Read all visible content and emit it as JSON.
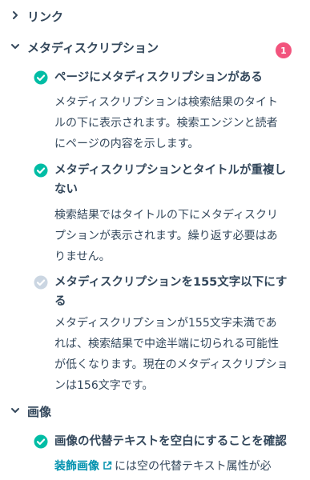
{
  "sections": {
    "links": {
      "title": "リンク",
      "expanded": false
    },
    "meta": {
      "title": "メタディスクリプション",
      "expanded": true,
      "badge": "1",
      "items": [
        {
          "status": "passed",
          "title": "ページにメタディスクリプションがある",
          "desc_lines": [
            "メタディスクリプションは検索結果のタイト",
            "ルの下に表示されます。検索エンジンと読者",
            "にページの内容を示します。"
          ]
        },
        {
          "status": "passed",
          "title_lines": [
            "メタディスクリプションとタイトルが重複し",
            "ない"
          ],
          "desc_lines": [
            "検索結果ではタイトルの下にメタディスクリ",
            "プションが表示されます。繰り返す必要はあ",
            "りません。"
          ]
        },
        {
          "status": "failed",
          "title_lines": [
            "メタディスクリプションを155文字以下にす",
            "る"
          ],
          "desc_lines": [
            "メタディスクリプションが155文字未満であ",
            "れば、検索結果で中途半端に切られる可能性",
            "が低くなります。現在のメタディスクリプショ",
            "ンは156文字です。"
          ]
        }
      ]
    },
    "images": {
      "title": "画像",
      "expanded": true,
      "items": [
        {
          "status": "passed",
          "title": "画像の代替テキストを空白にすることを確認",
          "link_text": "装飾画像",
          "desc_rest": "には空の代替テキスト属性が必"
        }
      ]
    }
  },
  "colors": {
    "accent": "#00bda5",
    "inactive": "#cbd6e2",
    "badge": "#f2547d",
    "link": "#0091ae",
    "text": "#33475b"
  },
  "icons": {
    "collapsed": "chevron-right-icon",
    "expanded": "chevron-down-icon",
    "passed": "check-circle-icon",
    "failed": "check-circle-inactive-icon",
    "external": "external-link-icon"
  }
}
